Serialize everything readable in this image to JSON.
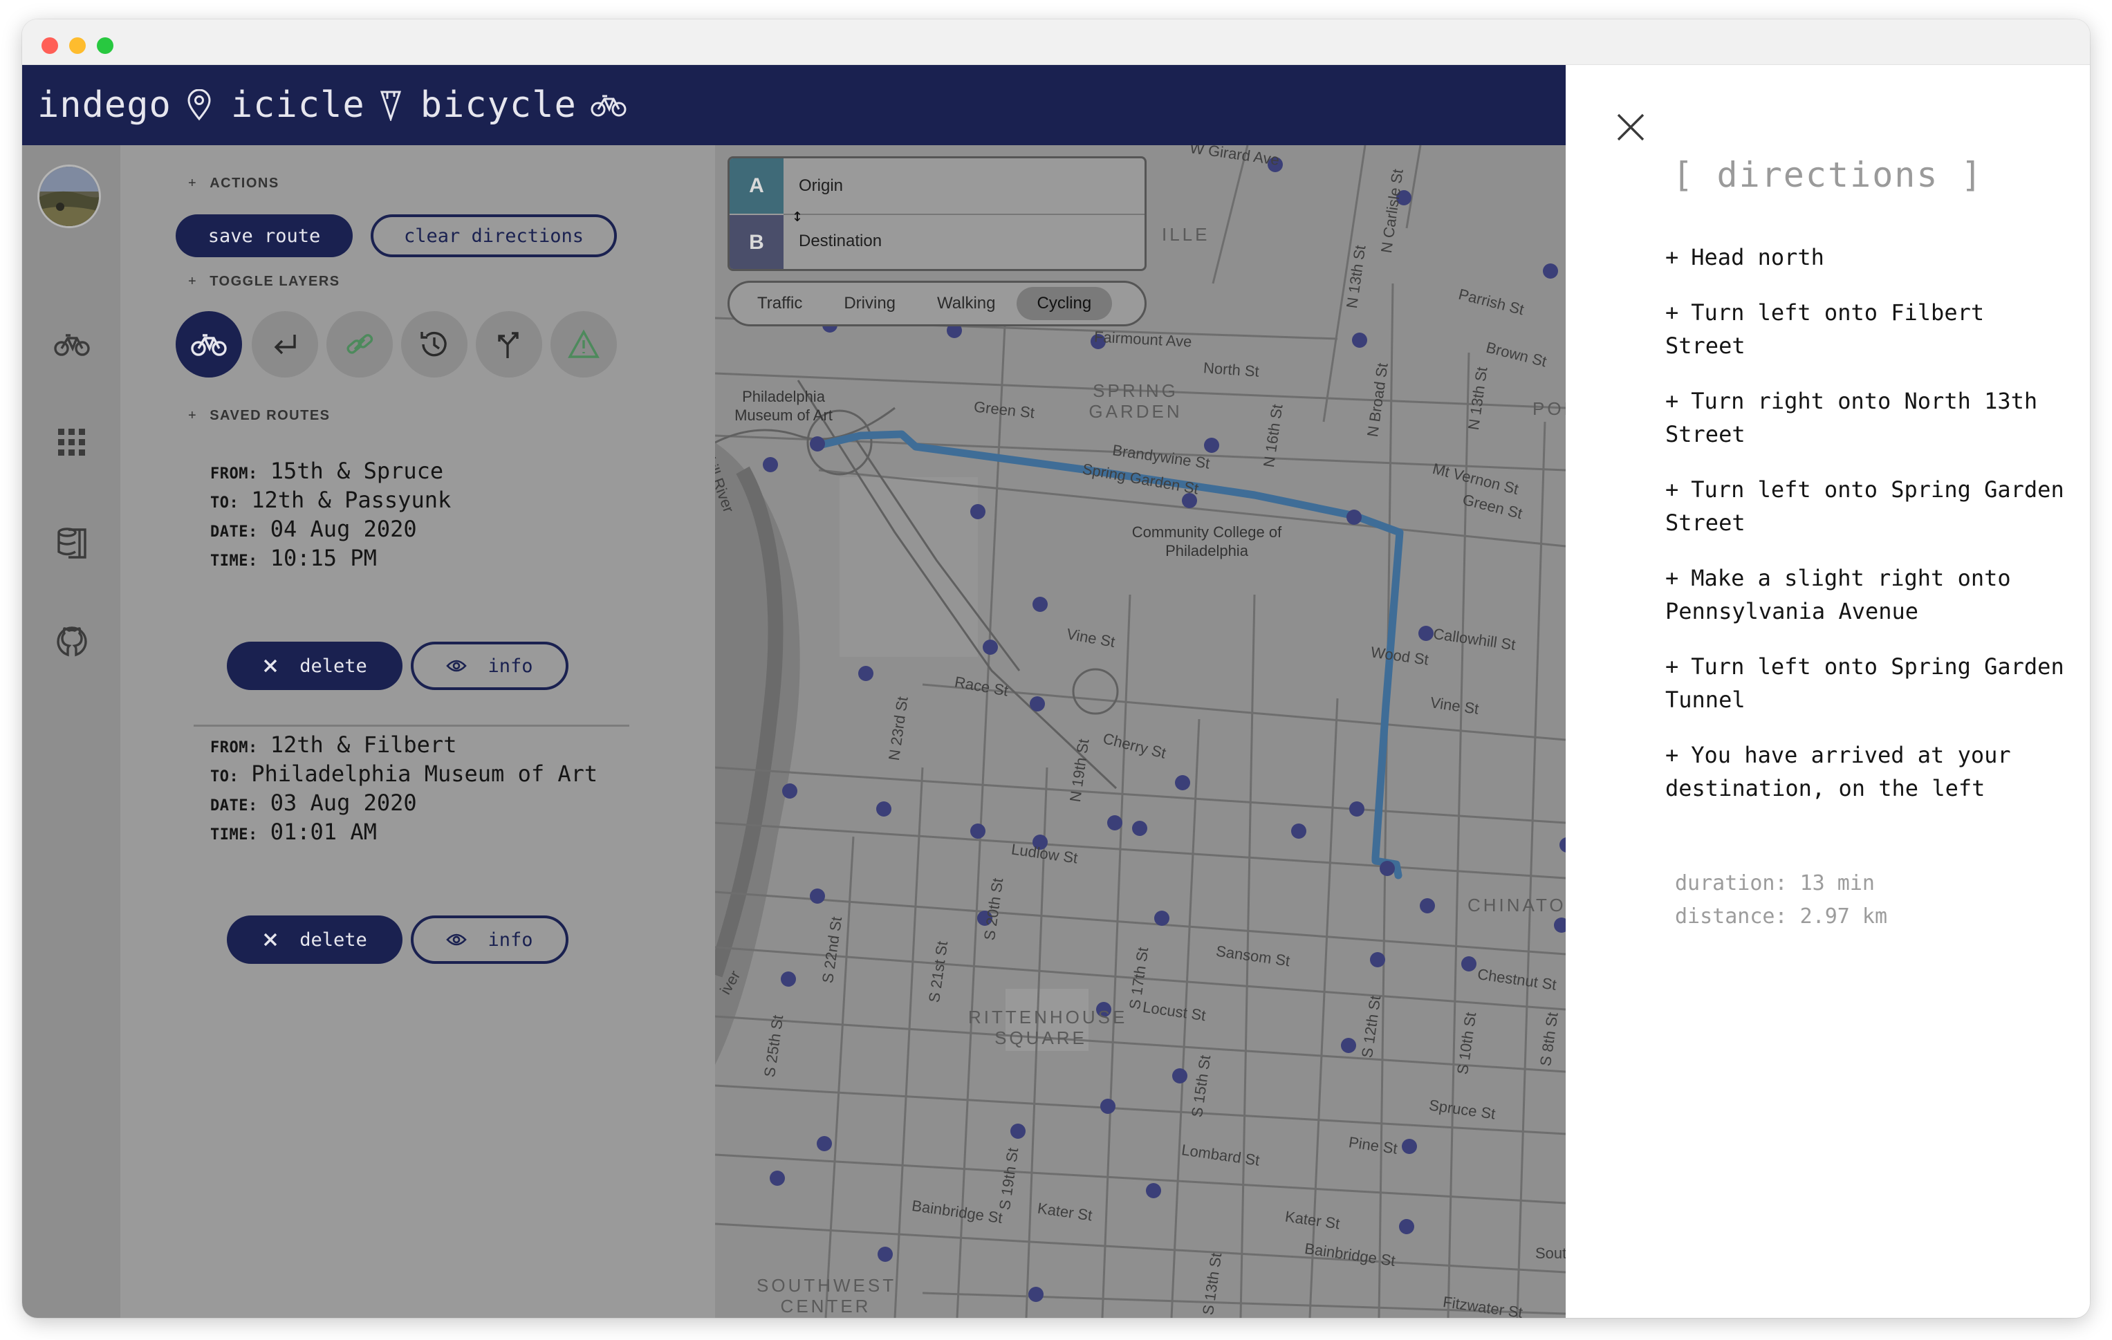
{
  "app": {
    "brand": [
      "indego",
      "icicle",
      "bicycle"
    ]
  },
  "sidebar": {
    "icons": [
      "bicycle-icon",
      "grid-icon",
      "database-icon",
      "github-icon"
    ]
  },
  "panel": {
    "actions_label": "ACTIONS",
    "save_route": "save route",
    "clear_directions": "clear directions",
    "toggle_layers_label": "TOGGLE LAYERS",
    "layers": [
      {
        "name": "bicycle-layer",
        "active": true
      },
      {
        "name": "return-layer",
        "active": false
      },
      {
        "name": "link-layer",
        "active": false
      },
      {
        "name": "history-layer",
        "active": false
      },
      {
        "name": "fork-layer",
        "active": false
      },
      {
        "name": "warning-layer",
        "active": false
      }
    ],
    "saved_routes_label": "SAVED ROUTES",
    "keys": {
      "from": "FROM:",
      "to": "TO:",
      "date": "DATE:",
      "time": "TIME:"
    },
    "delete_label": "delete",
    "info_label": "info",
    "routes": [
      {
        "from": "15th & Spruce",
        "to": "12th & Passyunk",
        "date": "04 Aug 2020",
        "time": "10:15 PM"
      },
      {
        "from": "12th & Filbert",
        "to": "Philadelphia Museum of Art",
        "date": "03 Aug 2020",
        "time": "01:01 AM"
      }
    ]
  },
  "map": {
    "origin_letter": "A",
    "destination_letter": "B",
    "origin_placeholder": "Origin",
    "destination_placeholder": "Destination",
    "modes": [
      "Traffic",
      "Driving",
      "Walking",
      "Cycling"
    ],
    "active_mode": "Cycling",
    "labels": {
      "w_girard": "W Girard Ave",
      "fairmount": "Fairmount Ave",
      "north_st": "North St",
      "green_st": "Green St",
      "brandywine": "Brandywine St",
      "spring_garden": "Spring Garden St",
      "vine": "Vine St",
      "vine2": "Vine St",
      "race": "Race St",
      "cherry": "Cherry St",
      "ludlow": "Ludlow St",
      "sansom": "Sansom St",
      "locust": "Locust St",
      "lombard": "Lombard St",
      "pine": "Pine St",
      "bainbridge": "Bainbridge St",
      "bainbridge2": "Bainbridge St",
      "kater": "Kater St",
      "kater2": "Kater St",
      "spruce": "Spruce St",
      "chestnut": "Chestnut St",
      "callowhill": "Callowhill St",
      "wood": "Wood St",
      "parrish": "Parrish St",
      "brown": "Brown St",
      "mt_vernon": "Mt Vernon St",
      "green2": "Green St",
      "fitzwater": "Fitzwater St",
      "n_broad": "N Broad St",
      "n_13th": "N 13th St",
      "n_13th2": "N 13th St",
      "n_16th": "N 16th St",
      "n_carlisle": "N Carlisle St",
      "n_23rd": "N 23rd St",
      "n_19th": "N 19th St",
      "s_20th": "S 20th St",
      "s_22nd": "S 22nd St",
      "s_21st": "S 21st St",
      "s_25th": "S 25th St",
      "s_17th": "S 17th St",
      "s_19th": "S 19th St",
      "s_15th": "S 15th St",
      "s_12th": "S 12th St",
      "s_10th": "S 10th St",
      "s_8th": "S 8th St",
      "s_13th": "S 13th St",
      "river": "kill River",
      "river2": "iver",
      "south": "Sout",
      "spring_garden_area": "SPRING GARDEN",
      "rittenhouse_area": "RITTENHOUSE SQUARE",
      "southwest_area": "SOUTHWEST CENTER CITY",
      "chinatown_area": "CHINATOW",
      "poplar_area": "POPLA",
      "ville_area": "ILLE",
      "museum_poi": "Philadelphia Museum of Art",
      "ccp_poi": "Community College of Philadelphia"
    }
  },
  "directions": {
    "title": "[ directions ]",
    "steps": [
      "Head north",
      "Turn left onto Filbert Street",
      "Turn right onto North 13th Street",
      "Turn left onto Spring Garden Street",
      "Make a slight right onto Pennsylvania Avenue",
      "Turn left onto Spring Garden Tunnel",
      "You have arrived at your destination, on the left"
    ],
    "duration": "duration: 13 min",
    "distance": "distance: 2.97 km"
  },
  "colors": {
    "navy": "#1a2150",
    "route": "#3f6d97",
    "station": "#3b3f78",
    "overlay_grey": "#9a9a9a"
  }
}
